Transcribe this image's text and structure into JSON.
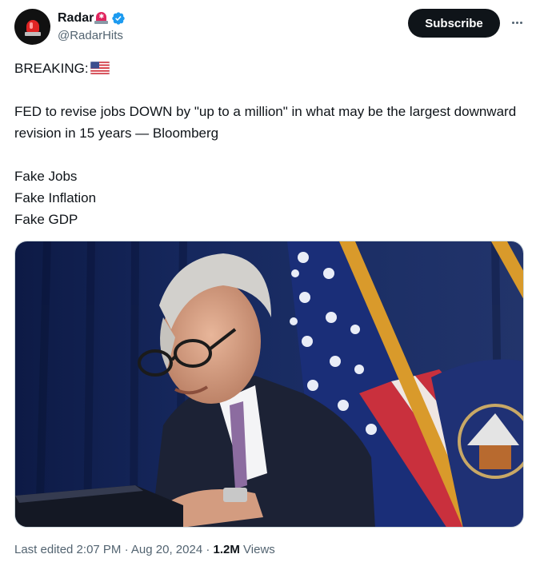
{
  "author": {
    "display_name": "Radar",
    "handle": "@RadarHits",
    "verified": true,
    "name_emoji": "police-siren",
    "avatar_icon": "siren-icon"
  },
  "actions": {
    "subscribe_label": "Subscribe",
    "more_icon": "more-horizontal-icon"
  },
  "tweet": {
    "line_breaking": "BREAKING:",
    "breaking_emoji": "us-flag",
    "line_main": "FED to revise jobs DOWN by \"up to a million\" in what may be the largest downward revision in 15 years — Bloomberg",
    "list": [
      "Fake Jobs",
      "Fake Inflation",
      "Fake GDP"
    ]
  },
  "media": {
    "type": "photo"
  },
  "meta": {
    "edited_label": "Last edited 2:07 PM · Aug 20, 2024 ·",
    "views_count": "1.2M",
    "views_label": "Views"
  },
  "colors": {
    "verified_blue": "#1d9bf0",
    "text_primary": "#0f1419",
    "text_secondary": "#536471",
    "button_dark": "#0f1419"
  }
}
